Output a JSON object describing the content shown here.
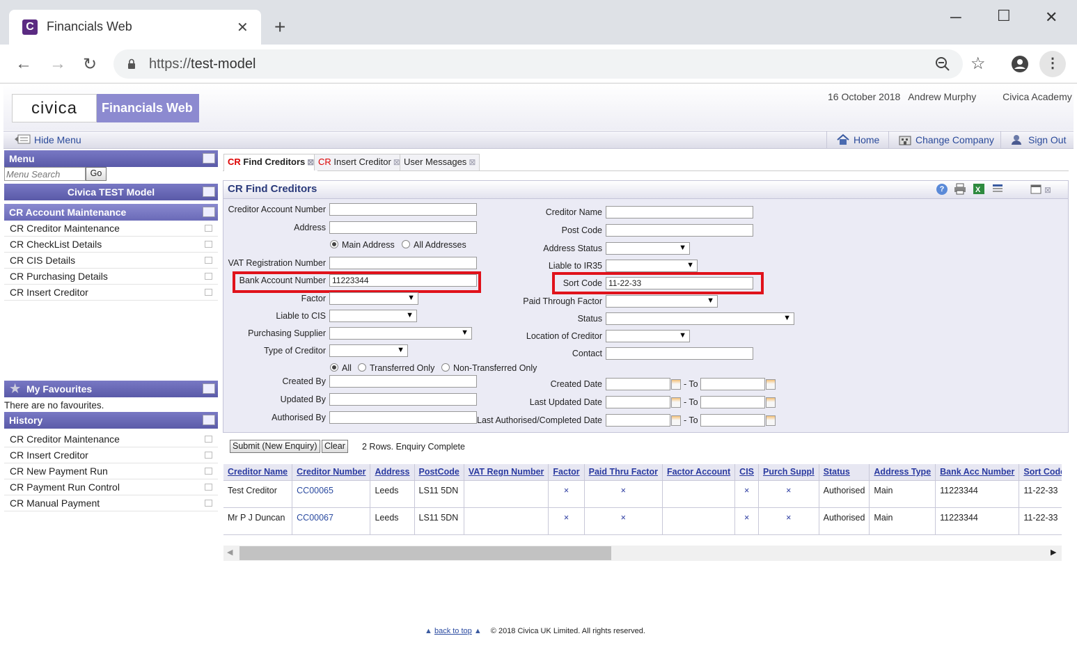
{
  "browser": {
    "tab_title": "Financials Web",
    "tab_favicon": "C",
    "new_tab": "+",
    "url_scheme": "https://",
    "url_host": "test-model",
    "icons": [
      "back-icon",
      "forward-icon",
      "reload-icon",
      "lock-icon",
      "zoom-icon",
      "star-icon",
      "account-icon",
      "menu-dots-icon"
    ]
  },
  "header": {
    "logo": "civica",
    "app_name": "Financials Web",
    "date": "16 October 2018",
    "user": "Andrew Murphy",
    "company": "Civica Academy"
  },
  "menubar": {
    "hide_menu": "Hide Menu",
    "home": "Home",
    "change_company": "Change Company",
    "sign_out": "Sign Out"
  },
  "sidebar": {
    "menu_title": "Menu",
    "search_placeholder": "Menu Search",
    "go": "Go",
    "model": "Civica TEST Model",
    "section": "CR Account Maintenance",
    "items": [
      "CR Creditor Maintenance",
      "CR CheckList Details",
      "CR CIS Details",
      "CR Purchasing Details",
      "CR Insert Creditor"
    ],
    "favourites_title": "My Favourites",
    "favourites_empty": "There are no favourites.",
    "history_title": "History",
    "history": [
      "CR Creditor Maintenance",
      "CR Insert Creditor",
      "CR New Payment Run",
      "CR Payment Run Control",
      "CR Manual Payment"
    ]
  },
  "tabs": [
    {
      "prefix": "CR",
      "label": "Find Creditors"
    },
    {
      "prefix": "CR",
      "label": "Insert Creditor"
    },
    {
      "prefix": "",
      "label": "User Messages"
    }
  ],
  "form": {
    "title": "CR Find Creditors",
    "creditor_account_number": "Creditor Account Number",
    "address": "Address",
    "main_address": "Main Address",
    "all_addresses": "All Addresses",
    "vat_registration_number": "VAT Registration Number",
    "bank_account_number": "Bank Account Number",
    "bank_account_value": "11223344",
    "factor": "Factor",
    "liable_to_cis": "Liable to CIS",
    "purchasing_supplier": "Purchasing Supplier",
    "type_of_creditor": "Type of Creditor",
    "all": "All",
    "transferred_only": "Transferred Only",
    "non_transferred_only": "Non-Transferred Only",
    "created_by": "Created By",
    "updated_by": "Updated By",
    "authorised_by": "Authorised By",
    "creditor_name": "Creditor Name",
    "post_code": "Post Code",
    "address_status": "Address Status",
    "liable_to_ir35": "Liable to IR35",
    "sort_code": "Sort Code",
    "sort_code_value": "11-22-33",
    "paid_through_factor": "Paid Through Factor",
    "status": "Status",
    "location_of_creditor": "Location of Creditor",
    "contact": "Contact",
    "created_date": "Created Date",
    "last_updated_date": "Last Updated Date",
    "last_authorised_date": "Last Authorised/Completed Date",
    "to": "- To"
  },
  "actions": {
    "submit": "Submit (New Enquiry)",
    "clear": "Clear",
    "status": "2 Rows. Enquiry Complete"
  },
  "grid": {
    "columns": [
      "Creditor Name",
      "Creditor Number",
      "Address",
      "PostCode",
      "VAT Regn Number",
      "Factor",
      "Paid Thru Factor",
      "Factor Account",
      "CIS",
      "Purch Suppl",
      "Status",
      "Address Type",
      "Bank Acc Number",
      "Sort Code"
    ],
    "rows": [
      [
        "Test Creditor",
        "CC00065",
        "Leeds",
        "LS11 5DN",
        "",
        "×",
        "×",
        "",
        "×",
        "×",
        "Authorised",
        "Main",
        "11223344",
        "11-22-33"
      ],
      [
        "Mr P J Duncan",
        "CC00067",
        "Leeds",
        "LS11 5DN",
        "",
        "×",
        "×",
        "",
        "×",
        "×",
        "Authorised",
        "Main",
        "11223344",
        "11-22-33"
      ]
    ]
  },
  "footer": {
    "back_to_top": "back to top",
    "copyright": "© 2018 Civica UK Limited. All rights reserved."
  }
}
